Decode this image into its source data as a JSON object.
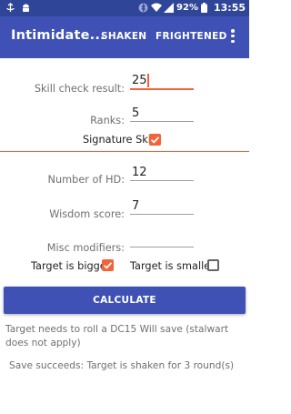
{
  "status_bar": {
    "battery": "92%",
    "time": "13:55",
    "icons": [
      "signal-icon",
      "android-icon",
      "bluetooth-icon",
      "wifi-icon",
      "cellular-icon",
      "battery-icon"
    ]
  },
  "app_bar": {
    "title": "Intimidate...",
    "actions": [
      "SHAKEN",
      "FRIGHTENED"
    ],
    "menu_icon": "more-vert-icon"
  },
  "form": {
    "skill_check": {
      "label": "Skill check result:",
      "value": "25"
    },
    "ranks": {
      "label": "Ranks:",
      "value": "5"
    },
    "signature_skill": {
      "label": "Signature Skill",
      "checked": true
    },
    "hd": {
      "label": "Number of HD:",
      "value": "12"
    },
    "wisdom": {
      "label": "Wisdom score:",
      "value": "7"
    },
    "misc": {
      "label": "Misc modifiers:",
      "value": ""
    },
    "bigger": {
      "label": "Target is bigger",
      "checked": true
    },
    "smaller": {
      "label": "Target is smaller",
      "checked": false
    }
  },
  "button": {
    "label": "CALCULATE"
  },
  "results": {
    "line1": "Target needs to roll a DC15 Will save (stalwart does not apply)",
    "line2": "Save succeeds: Target is shaken for 3 round(s)"
  },
  "colors": {
    "primary": "#3f51b5",
    "status": "#2f4598",
    "accent": "#f4623a"
  }
}
